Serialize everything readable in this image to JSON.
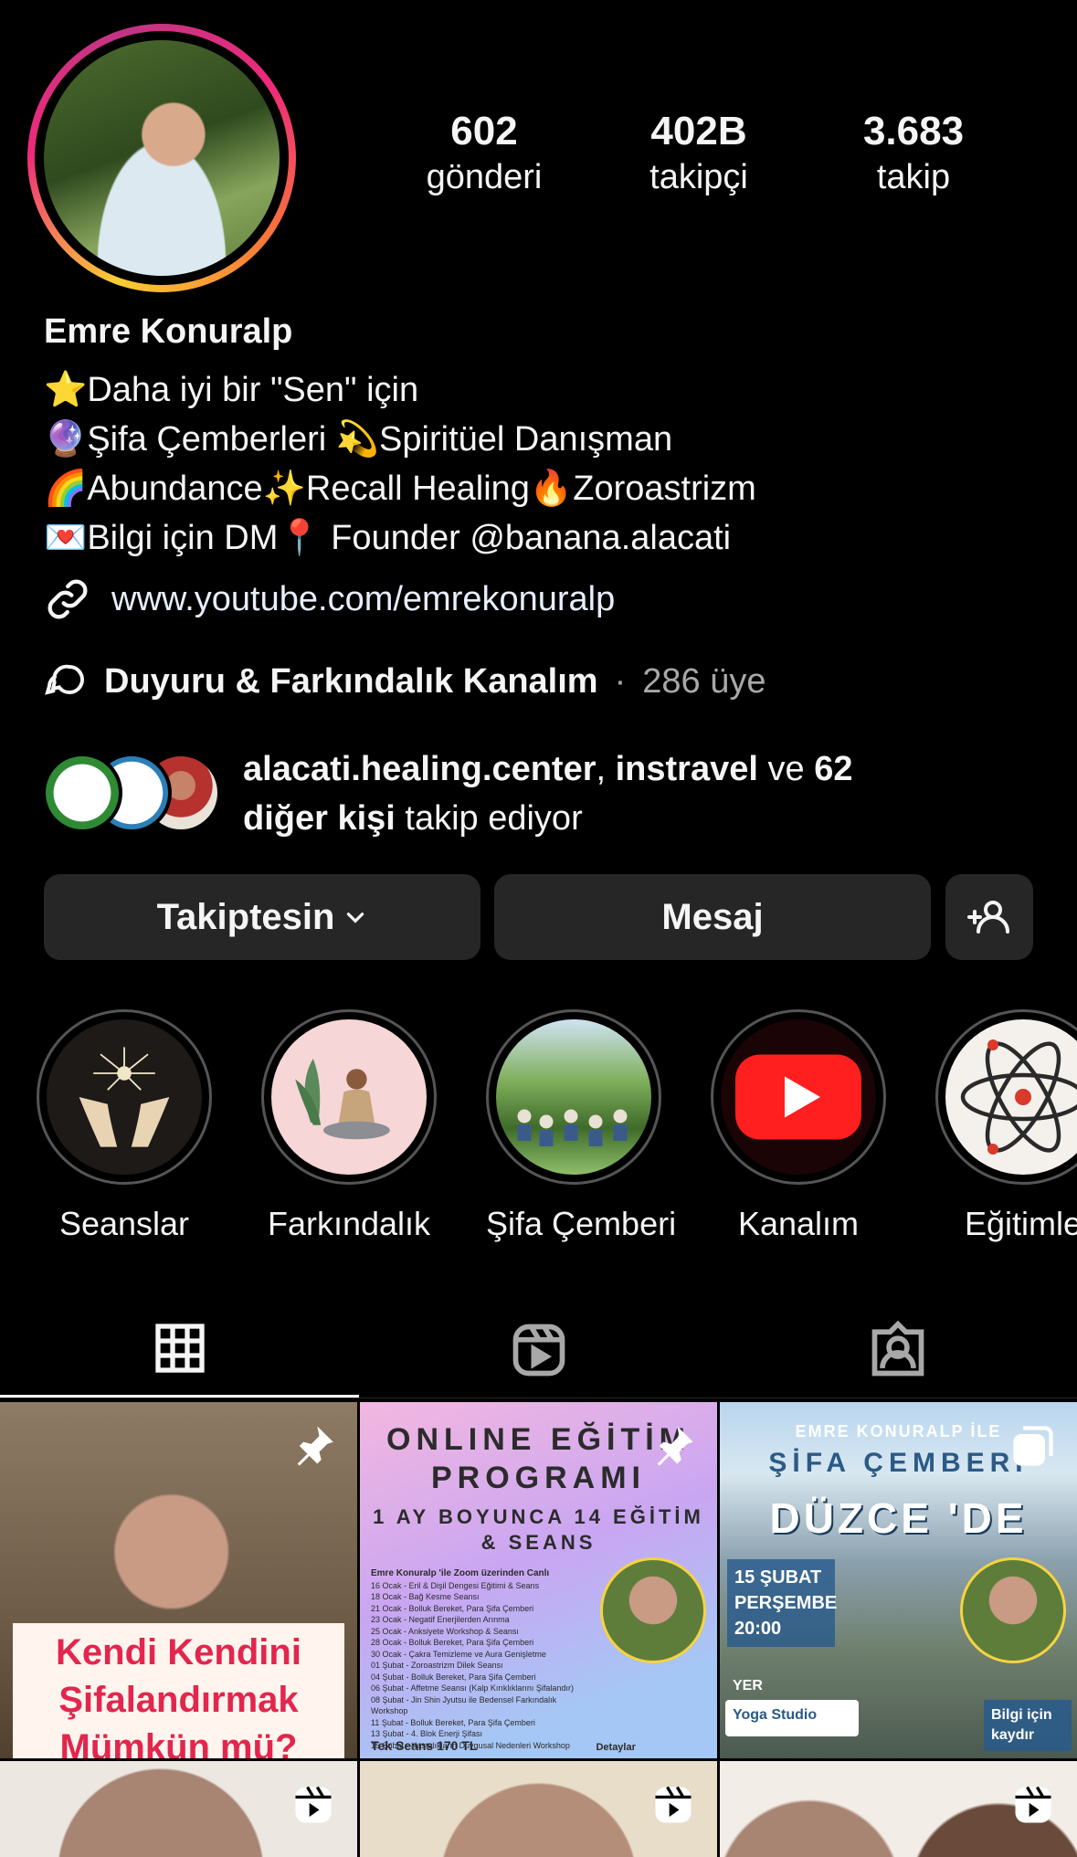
{
  "profile": {
    "name": "Emre Konuralp",
    "stats": [
      {
        "value": "602",
        "label": "gönderi"
      },
      {
        "value": "402B",
        "label": "takipçi"
      },
      {
        "value": "3.683",
        "label": "takip"
      }
    ],
    "bio": [
      "⭐Daha iyi bir \"Sen\" için",
      "🔮Şifa Çemberleri 💫Spiritüel Danışman",
      "🌈Abundance✨Recall Healing🔥Zoroastrizm",
      "💌Bilgi için DM📍 Founder @banana.alacati"
    ],
    "link": "www.youtube.com/emrekonuralp",
    "channel": {
      "name": "Duyuru & Farkındalık Kanalım",
      "separator": "·",
      "members": "286 üye"
    },
    "followed_by": {
      "user1": "alacati.healing.center",
      "comma": ", ",
      "user2": "instravel",
      "and": " ve ",
      "count": "62",
      "others": "diğer kişi",
      "suffix": " takip ediyor"
    }
  },
  "buttons": {
    "following": "Takiptesin",
    "message": "Mesaj"
  },
  "highlights": [
    {
      "label": "Seanslar"
    },
    {
      "label": "Farkındalık"
    },
    {
      "label": "Şifa Çemberi"
    },
    {
      "label": "Kanalım"
    },
    {
      "label": "Eğitimle"
    }
  ],
  "posts": {
    "p1_caption": "Kendi Kendini Şifalandırmak Mümkün mü?",
    "p2_title": "ONLINE EĞİTİM PROGRAMI",
    "p2_subtitle": "1 AY BOYUNCA 14 EĞİTİM & SEANS",
    "p2_lines": [
      "Emre Konuralp 'ile Zoom üzerinden Canlı",
      "16 Ocak - Eril & Dişil Dengesi Eğitimi & Seans",
      "18 Ocak - Bağ Kesme Seansı",
      "21 Ocak - Bolluk Bereket, Para Şifa Çemberi",
      "23 Ocak - Negatif Enerjilerden Arınma",
      "25 Ocak - Anksiyete Workshop & Seansı",
      "28 Ocak - Bolluk Bereket, Para Şifa Çemberi",
      "30 Ocak - Çakra Temizleme ve Aura Genişletme",
      "01 Şubat - Zoroastrizm Dilek Seansı",
      "04 Şubat - Bolluk Bereket, Para Şifa Çemberi",
      "06 Şubat - Affetme Seansı (Kalp Kırıklıklarını Şifalandır)",
      "08 Şubat - Jin Shin Jyutsu ile Bedensel Farkındalık Workshop",
      "11 Şubat - Bolluk Bereket, Para Şifa Çemberi",
      "13 Şubat - 4. Blok Enerji Şifası",
      "15 Şubat - Hastalıkların Duygusal Nedenleri Workshop"
    ],
    "p2_price": "Tek Seans 170 TL",
    "p2_details": "Detaylar",
    "p3_top": "EMRE KONURALP İLE",
    "p3_title": "ŞİFA ÇEMBERİ",
    "p3_city": "DÜZCE 'DE",
    "p3_date": "15 ŞUBAT PERŞEMBE 20:00",
    "p3_place_label": "YER",
    "p3_place": "Yoga Studio",
    "p3_cta": "Bilgi için kaydır"
  },
  "colors": {
    "background": "#000000",
    "button": "#262626",
    "text": "#f5f5f5",
    "muted": "#a8a8a8"
  }
}
